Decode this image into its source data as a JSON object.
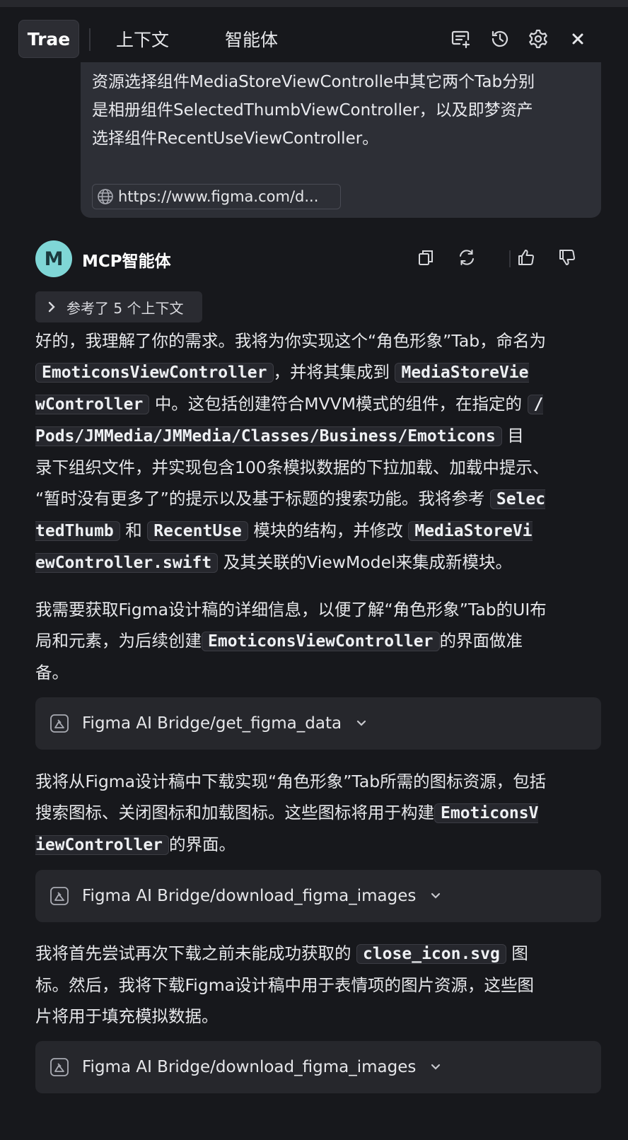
{
  "header": {
    "tabs": [
      "Trae",
      "上下文",
      "智能体"
    ],
    "icons": [
      "new-chat-icon",
      "history-icon",
      "settings-icon",
      "close-icon"
    ]
  },
  "user_message": {
    "lines": [
      "资源选择组件MediaStoreViewControlle中其它两个Tab分别",
      "是相册组件SelectedThumbViewController，以及即梦资产",
      "选择组件RecentUseViewController。"
    ],
    "link": "https://www.figma.com/d..."
  },
  "agent": {
    "avatar_letter": "M",
    "name": "MCP智能体",
    "context_label": "参考了 5 个上下文"
  },
  "messages": {
    "p1": {
      "l1": "好的，我理解了你的需求。我将为你实现这个“角色形象”Tab，命名为",
      "l2_code1": "EmoticonsViewController",
      "l2_text": "，并将其集成到",
      "l2_code2": "MediaStoreVie",
      "l3_code1": "wController",
      "l3_text": "中。这包括创建符合MVVM模式的组件，在指定的",
      "l3_code2": "/",
      "l4_code": "Pods/JMMedia/JMMedia/Classes/Business/Emoticons",
      "l4_text": "目",
      "l5": "录下组织文件，并实现包含100条模拟数据的下拉加载、加载中提示、",
      "l6_text": "“暂时没有更多了”的提示以及基于标题的搜索功能。我将参考",
      "l6_code": "Selec",
      "l7_code1": "tedThumb",
      "l7_text1": "和",
      "l7_code2": "RecentUse",
      "l7_text2": "模块的结构，并修改",
      "l7_code3": "MediaStoreVi",
      "l8_code": "ewController.swift",
      "l8_text": "及其关联的ViewModel来集成新模块。"
    },
    "p2": {
      "l1": "我需要获取Figma设计稿的详细信息，以便了解“角色形象”Tab的UI布",
      "l2_text": "局和元素，为后续创建",
      "l2_code": "EmoticonsViewController",
      "l2_text2": "的界面做准",
      "l3": "备。"
    },
    "tool1": "Figma AI Bridge/get_figma_data",
    "p3": {
      "l1": "我将从Figma设计稿中下载实现“角色形象”Tab所需的图标资源，包括",
      "l2_text": "搜索图标、关闭图标和加载图标。这些图标将用于构建",
      "l2_code": "EmoticonsV",
      "l3_code": "iewController",
      "l3_text": "的界面。"
    },
    "tool2": "Figma AI Bridge/download_figma_images",
    "p4": {
      "l1_text": "我将首先尝试再次下载之前未能成功获取的",
      "l1_code": "close_icon.svg",
      "l1_text2": "图",
      "l2": "标。然后，我将下载Figma设计稿中用于表情项的图片资源，这些图",
      "l3": "片将用于填充模拟数据。"
    },
    "tool3": "Figma AI Bridge/download_figma_images"
  }
}
